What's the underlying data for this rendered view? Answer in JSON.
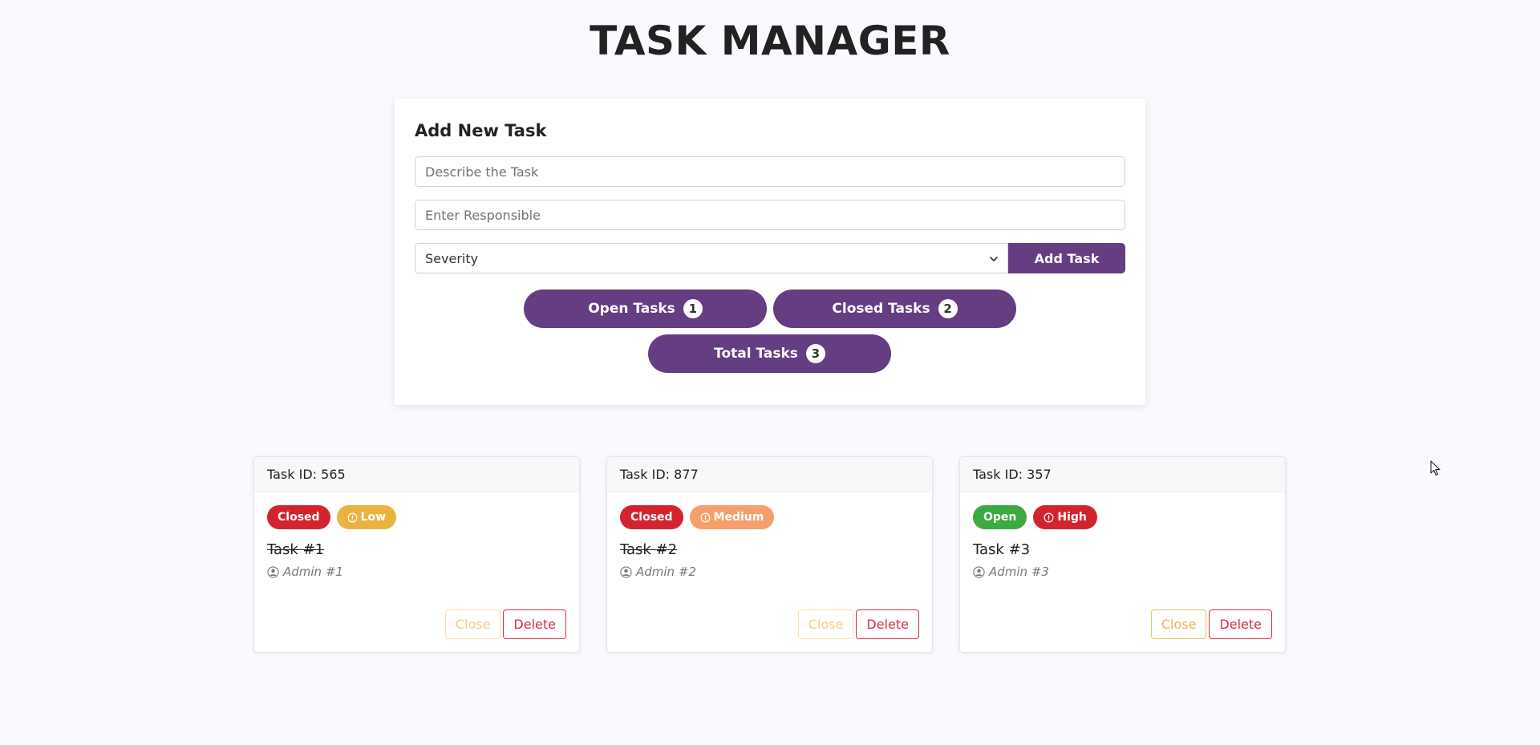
{
  "header": {
    "title": "TASK MANAGER"
  },
  "form": {
    "heading": "Add New Task",
    "description_placeholder": "Describe the Task",
    "description_value": "",
    "responsible_placeholder": "Enter Responsible",
    "responsible_value": "",
    "severity_selected": "Severity",
    "add_button_label": "Add Task"
  },
  "counters": {
    "open_label": "Open Tasks",
    "open_count": "1",
    "closed_label": "Closed Tasks",
    "closed_count": "2",
    "total_label": "Total Tasks",
    "total_count": "3"
  },
  "colors": {
    "accent": "#643d82",
    "status_closed": "#d3232f",
    "status_open": "#3aaa41",
    "severity_low": "#eab33f",
    "severity_medium": "#f5a06a",
    "severity_high": "#d3232f"
  },
  "tasks": [
    {
      "id_label": "Task ID: 565",
      "status": "Closed",
      "severity": "Low",
      "title": "Task #1",
      "assignee": "Admin #1",
      "close_label": "Close",
      "delete_label": "Delete"
    },
    {
      "id_label": "Task ID: 877",
      "status": "Closed",
      "severity": "Medium",
      "title": "Task #2",
      "assignee": "Admin #2",
      "close_label": "Close",
      "delete_label": "Delete"
    },
    {
      "id_label": "Task ID: 357",
      "status": "Open",
      "severity": "High",
      "title": "Task #3",
      "assignee": "Admin #3",
      "close_label": "Close",
      "delete_label": "Delete"
    }
  ]
}
